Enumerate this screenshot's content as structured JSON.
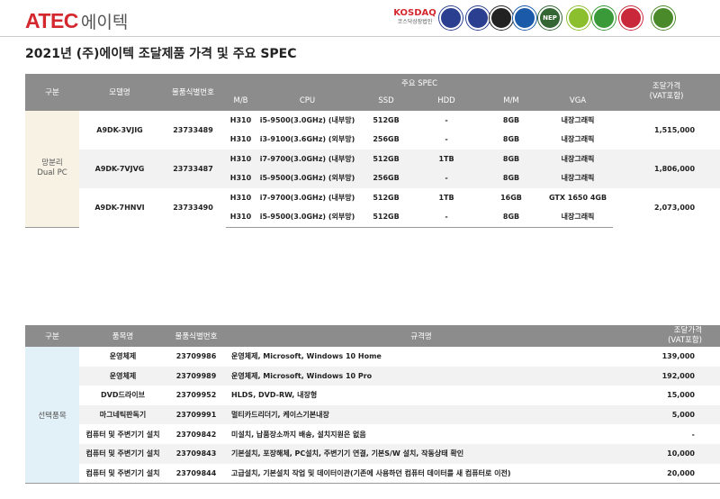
{
  "header": {
    "logo_text": "ATEC",
    "logo_korean": "에이텍",
    "badges": [
      {
        "name": "kosdaq-badge",
        "text": "KOSDAQ",
        "sub": "코스닥상장법인",
        "color": "#d4282f"
      },
      {
        "name": "certification-badge-1",
        "text": "",
        "sub": "",
        "color": "#2a3f8f"
      },
      {
        "name": "certification-badge-2",
        "text": "",
        "sub": "",
        "color": "#2a3f8f"
      },
      {
        "name": "certification-badge-3",
        "text": "",
        "sub": "",
        "color": "#222222"
      },
      {
        "name": "certification-badge-4",
        "text": "",
        "sub": "",
        "color": "#1a5aa8"
      },
      {
        "name": "certification-badge-5",
        "text": "NEP",
        "sub": "",
        "color": "#336633"
      },
      {
        "name": "certification-badge-6",
        "text": "",
        "sub": "",
        "color": "#8bbf2d"
      },
      {
        "name": "certification-badge-7",
        "text": "",
        "sub": "",
        "color": "#3a9a3a"
      },
      {
        "name": "certification-badge-8",
        "text": "",
        "sub": "",
        "color": "#c8283a"
      },
      {
        "name": "certification-badge-9",
        "text": "",
        "sub": "",
        "color": "#4a8a2a"
      }
    ]
  },
  "page_title": "2021년 (주)에이텍 조달제품 가격 및 주요 SPEC",
  "spec_table": {
    "headers": {
      "category": "구분",
      "model": "모델명",
      "item_code": "물품식별번호",
      "spec_group": "주요 SPEC",
      "price": "조달가격\n(VAT포함)",
      "mb": "M/B",
      "cpu": "CPU",
      "ssd": "SSD",
      "hdd": "HDD",
      "mm": "M/M",
      "vga": "VGA"
    },
    "category_label": "망분리\nDual PC",
    "groups": [
      {
        "model": "A9DK-3VJIG",
        "item_code": "23733489",
        "price": "1,515,000",
        "rows": [
          {
            "mb": "H310",
            "cpu": "i5-9500(3.0GHz) (내부망)",
            "ssd": "512GB",
            "hdd": "-",
            "mm": "8GB",
            "vga": "내장그래픽"
          },
          {
            "mb": "H310",
            "cpu": "i3-9100(3.6GHz) (외부망)",
            "ssd": "256GB",
            "hdd": "-",
            "mm": "8GB",
            "vga": "내장그래픽"
          }
        ]
      },
      {
        "model": "A9DK-7VJVG",
        "item_code": "23733487",
        "price": "1,806,000",
        "rows": [
          {
            "mb": "H310",
            "cpu": "i7-9700(3.0GHz) (내부망)",
            "ssd": "512GB",
            "hdd": "1TB",
            "mm": "8GB",
            "vga": "내장그래픽"
          },
          {
            "mb": "H310",
            "cpu": "i5-9500(3.0GHz) (외부망)",
            "ssd": "256GB",
            "hdd": "-",
            "mm": "8GB",
            "vga": "내장그래픽"
          }
        ]
      },
      {
        "model": "A9DK-7HNVI",
        "item_code": "23733490",
        "price": "2,073,000",
        "rows": [
          {
            "mb": "H310",
            "cpu": "i7-9700(3.0GHz) (내부망)",
            "ssd": "512GB",
            "hdd": "1TB",
            "mm": "16GB",
            "vga": "GTX 1650 4GB"
          },
          {
            "mb": "H310",
            "cpu": "i5-9500(3.0GHz) (외부망)",
            "ssd": "512GB",
            "hdd": "-",
            "mm": "8GB",
            "vga": "내장그래픽"
          }
        ]
      }
    ]
  },
  "option_table": {
    "headers": {
      "category": "구분",
      "item_name": "품목명",
      "item_code": "물품식별번호",
      "spec": "규격명",
      "price": "조달가격\n(VAT포함)"
    },
    "category_label": "선택품목",
    "rows": [
      {
        "name": "운영체제",
        "code": "23709986",
        "spec": "운영체제, Microsoft, Windows 10 Home",
        "price": "139,000"
      },
      {
        "name": "운영체제",
        "code": "23709989",
        "spec": "운영체제, Microsoft, Windows 10 Pro",
        "price": "192,000"
      },
      {
        "name": "DVD드라이브",
        "code": "23709952",
        "spec": "HLDS, DVD-RW, 내장형",
        "price": "15,000"
      },
      {
        "name": "마그네틱판독기",
        "code": "23709991",
        "spec": "멀티카드리더기, 케이스기본내장",
        "price": "5,000"
      },
      {
        "name": "컴퓨터 및 주변기기 설치",
        "code": "23709842",
        "spec": "미설치, 납품장소까지 배송, 설치지원은 없음",
        "price": "-"
      },
      {
        "name": "컴퓨터 및 주변기기 설치",
        "code": "23709843",
        "spec": "기본설치, 포장해체, PC설치, 주변기기 연결, 기본S/W 설치, 작동상태 확인",
        "price": "10,000"
      },
      {
        "name": "컴퓨터 및 주변기기 설치",
        "code": "23709844",
        "spec": "고급설치, 기본설치 작업 및 데이터이관(기존에 사용하던 컴퓨터 데이터를 새 컴퓨터로 이전)",
        "price": "20,000"
      }
    ]
  }
}
